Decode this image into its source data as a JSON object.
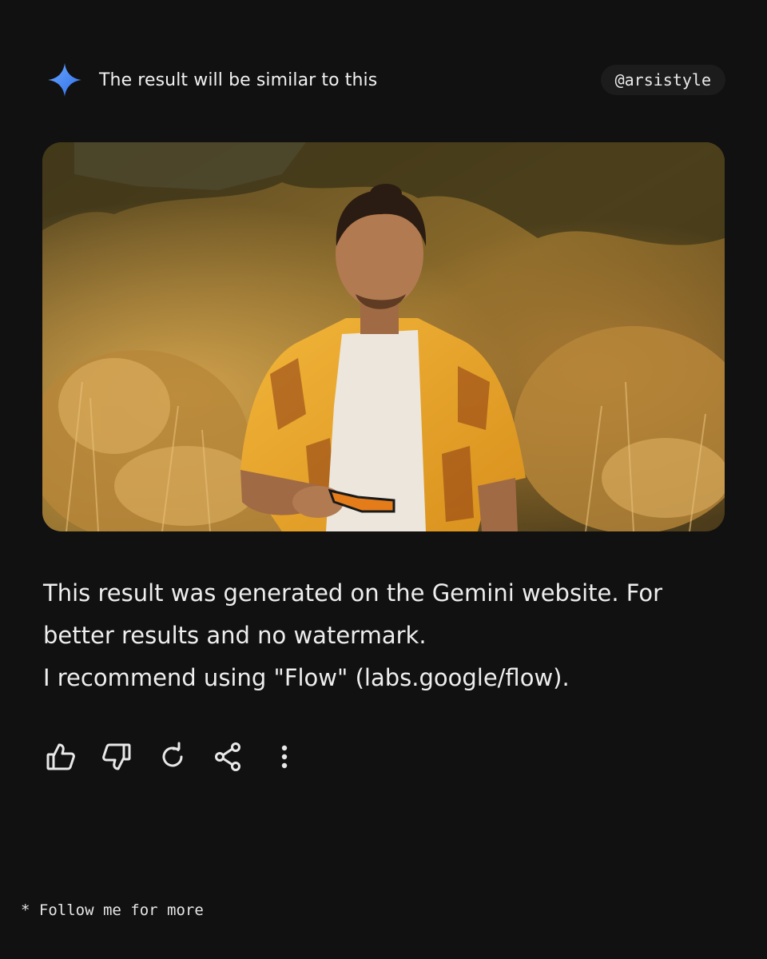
{
  "header": {
    "icon": "gemini-sparkle-icon",
    "title": "The result will be similar to this",
    "handle": "@arsistyle"
  },
  "image": {
    "subject": "Man in yellow patterned shirt holding orange sunglasses among dry golden desert shrubs"
  },
  "message": {
    "lines": [
      "This result was generated on the Gemini website. For",
      "better results and no watermark.",
      "I recommend using \"Flow\" (labs.google/flow)."
    ]
  },
  "actions": [
    {
      "icon": "thumbs-up-icon"
    },
    {
      "icon": "thumbs-down-icon"
    },
    {
      "icon": "regenerate-icon"
    },
    {
      "icon": "share-icon"
    },
    {
      "icon": "more-vertical-icon"
    }
  ],
  "footer": {
    "text": "* Follow me for more"
  },
  "colors": {
    "background": "#111111",
    "text": "#eeeeee",
    "handle_bg": "#1c1c1c",
    "gem_blue": "#4f8ef7"
  }
}
